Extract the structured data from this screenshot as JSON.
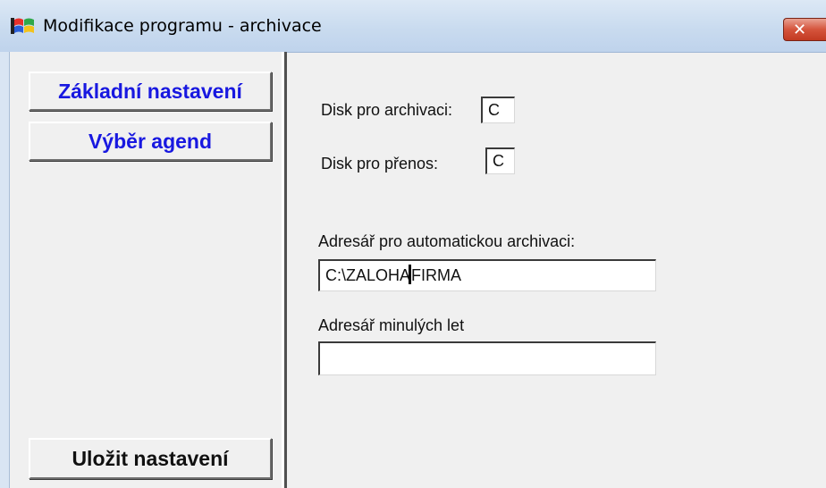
{
  "window": {
    "title": "Modifikace programu - archivace",
    "close_glyph": "✕",
    "app_icon": "windows-flag-icon"
  },
  "sidebar": {
    "buttons": {
      "basic_settings": "Základní nastavení",
      "select_agendas": "Výběr agend",
      "save_settings": "Uložit nastavení"
    }
  },
  "form": {
    "archive_disk_label": "Disk pro archivaci:",
    "archive_disk_value": "C",
    "transfer_disk_label": "Disk pro přenos:",
    "transfer_disk_value": "C",
    "auto_archive_dir_label": "Adresář pro automatickou archivaci:",
    "auto_archive_dir_value_before_caret": "C:\\ZALOHA",
    "auto_archive_dir_value_after_caret": "FIRMA",
    "past_years_dir_label": "Adresář minulých let",
    "past_years_dir_value": ""
  },
  "colors": {
    "nav_text": "#1818e0",
    "close_button": "#d5543c"
  }
}
